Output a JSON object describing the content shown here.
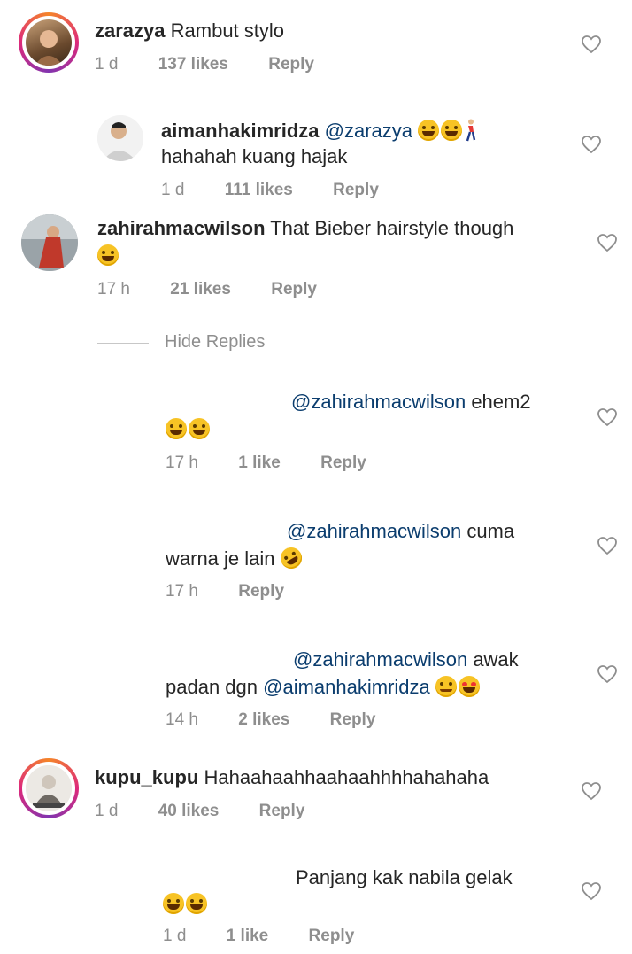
{
  "comments": [
    {
      "username": "zarazya",
      "text": "Rambut stylo",
      "time": "1 d",
      "likes": "137 likes",
      "reply": "Reply"
    },
    {
      "username": "aimanhakimridza",
      "mention": "@zarazya",
      "text": "hahahah kuang hajak",
      "time": "1 d",
      "likes": "111 likes",
      "reply": "Reply"
    },
    {
      "username": "zahirahmacwilson",
      "text": "That Bieber hairstyle though",
      "time": "17 h",
      "likes": "21 likes",
      "reply": "Reply"
    },
    {
      "mention": "@zahirahmacwilson",
      "text": "ehem2",
      "time": "17 h",
      "likes": "1 like",
      "reply": "Reply"
    },
    {
      "mention": "@zahirahmacwilson",
      "text_line1": "cuma",
      "text_line2": "warna je lain",
      "time": "17 h",
      "reply": "Reply"
    },
    {
      "mention": "@zahirahmacwilson",
      "text_line1": "awak",
      "text_line2": "padan dgn",
      "mention2": "@aimanhakimridza",
      "time": "14 h",
      "likes": "2 likes",
      "reply": "Reply"
    },
    {
      "username": "kupu_kupu",
      "text": "Hahaahaahhaahaahhhhahahaha",
      "time": "1 d",
      "likes": "40 likes",
      "reply": "Reply"
    },
    {
      "text": "Panjang kak nabila gelak",
      "time": "1 d",
      "likes": "1 like",
      "reply": "Reply"
    }
  ],
  "hide_replies": "Hide Replies",
  "icons": {
    "like": "heart-outline-icon",
    "emoji_laugh": "grinning-squinting-face-emoji",
    "emoji_rofl": "rolling-on-floor-laughing-emoji",
    "emoji_blush": "smiling-face-emoji",
    "emoji_heart_eyes": "heart-eyes-emoji",
    "runner": "person-running-emoji"
  },
  "colors": {
    "mention": "#0b3d6e",
    "meta": "#8e8e8e",
    "text": "#262626"
  }
}
